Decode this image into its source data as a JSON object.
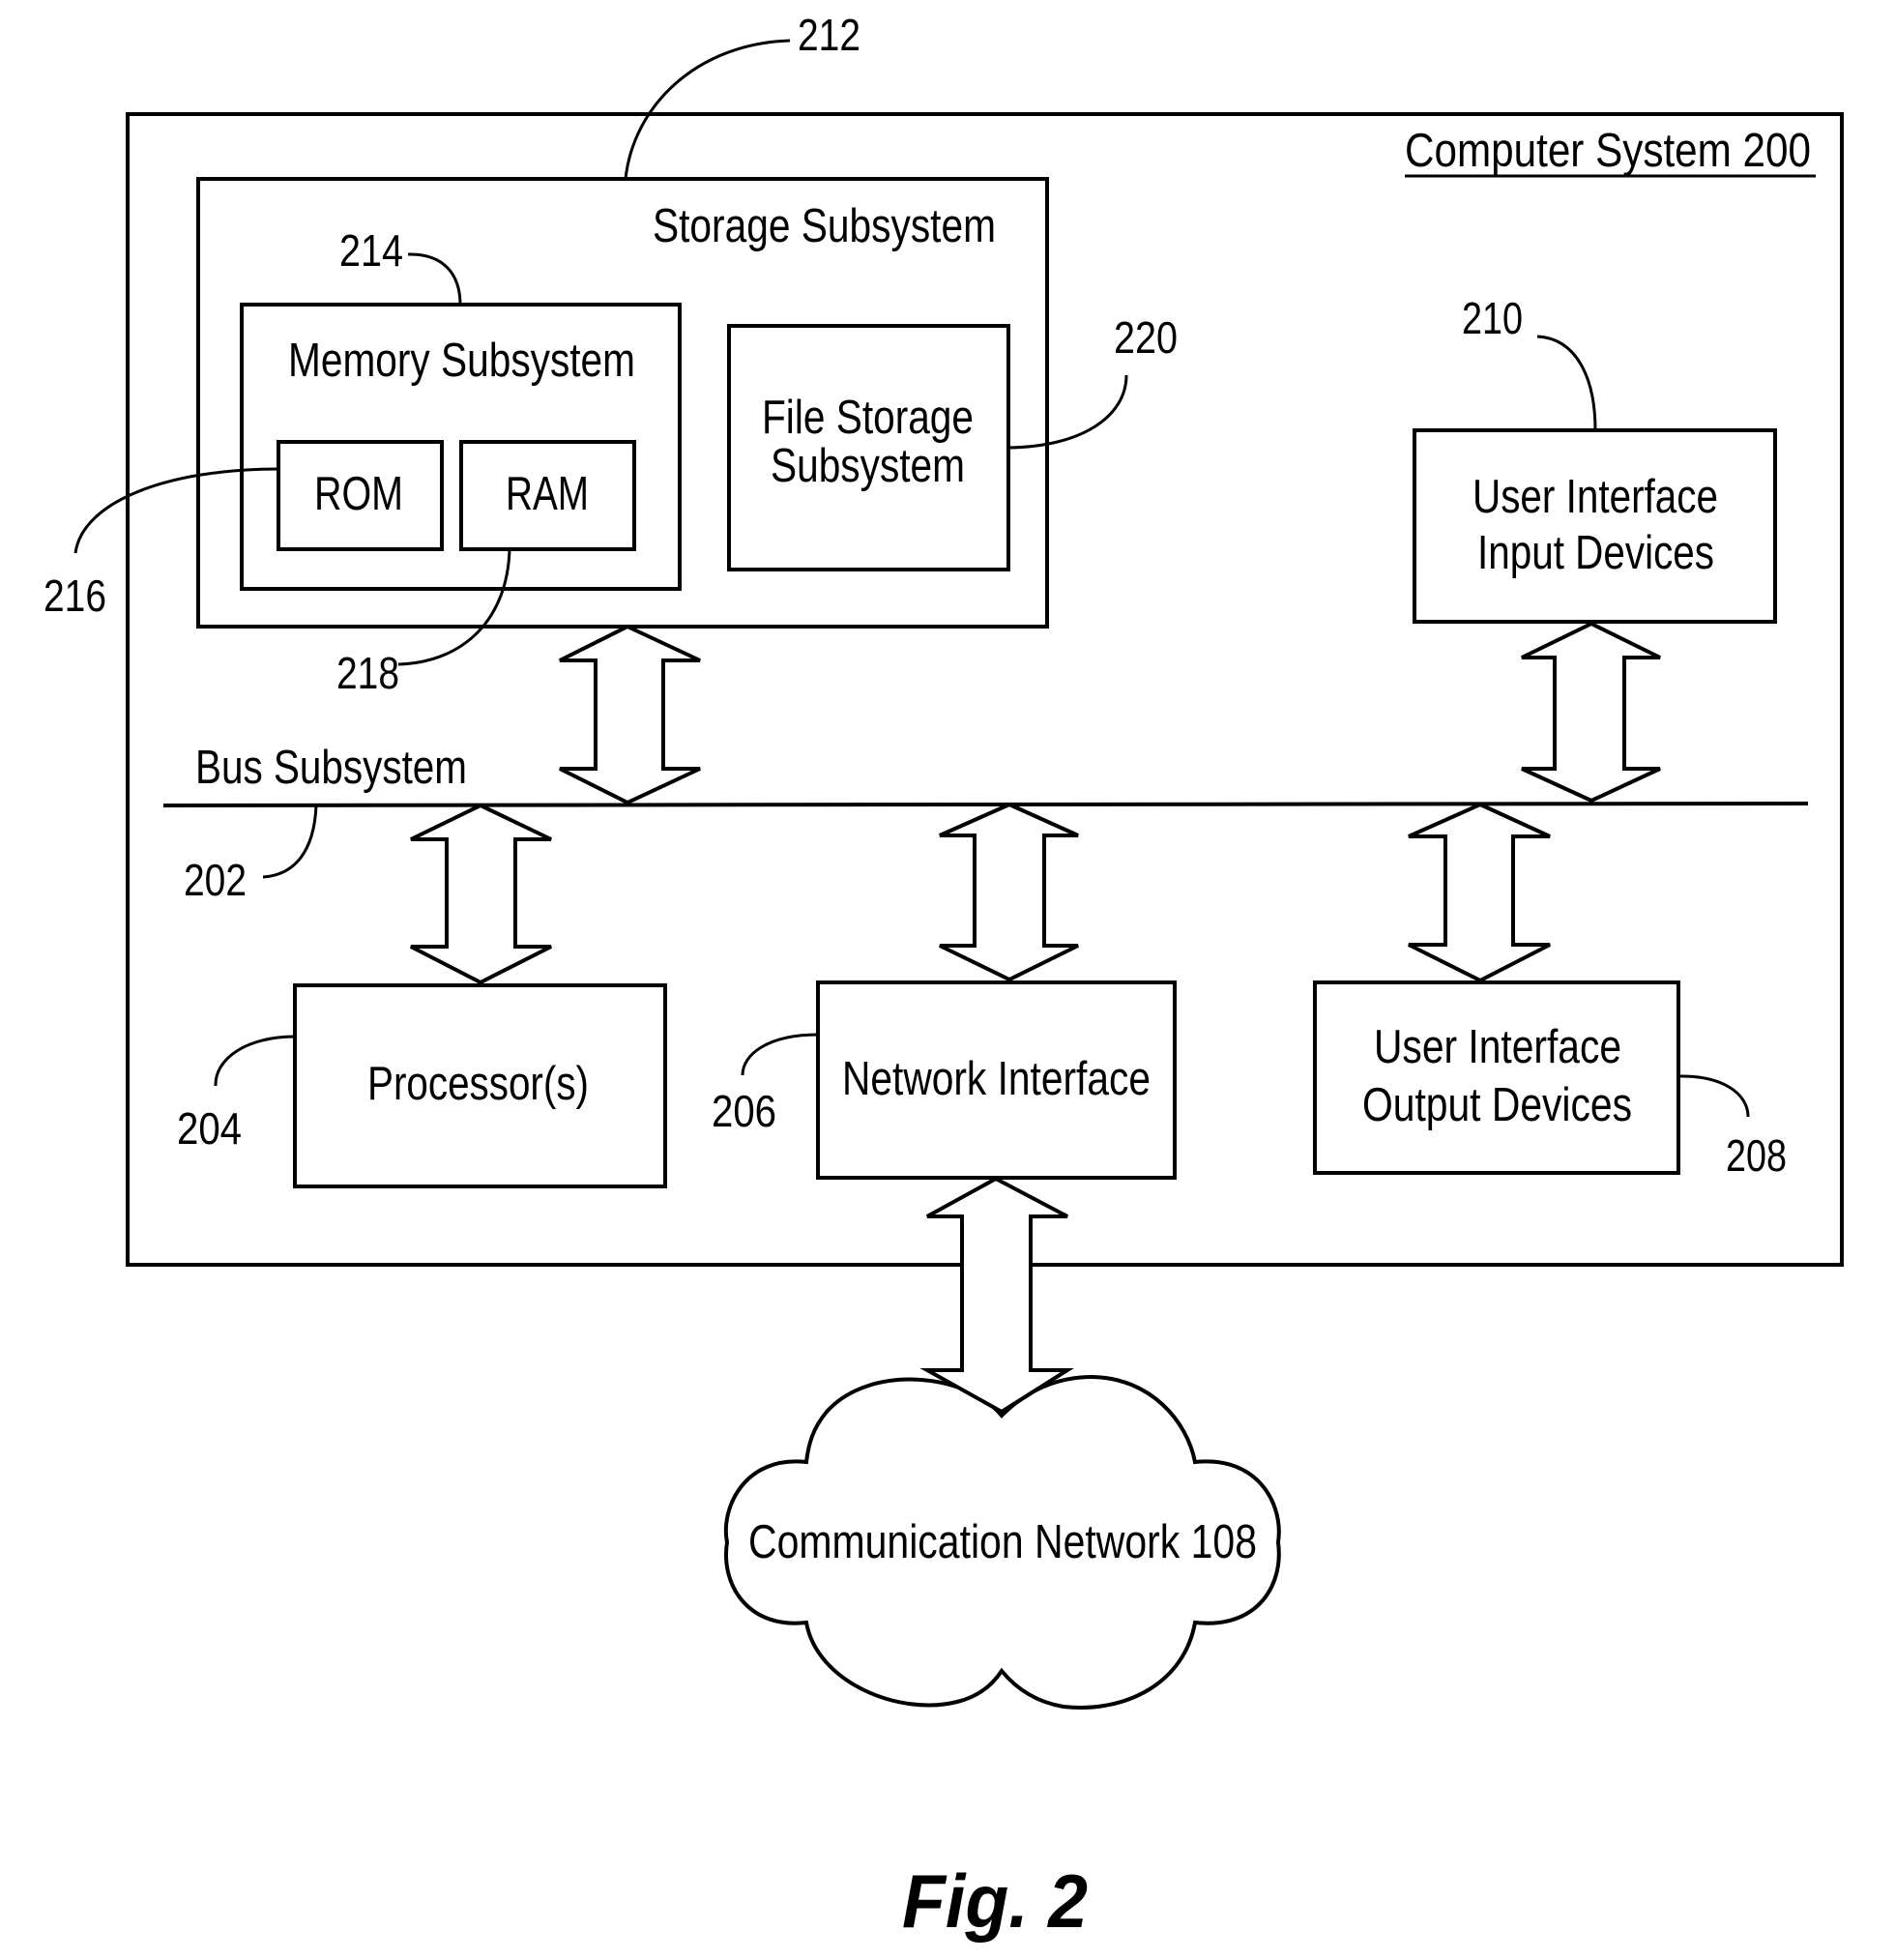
{
  "figure": {
    "caption": "Fig. 2",
    "system_title": "Computer System  200"
  },
  "blocks": {
    "storage": {
      "label": "Storage Subsystem",
      "ref": "212"
    },
    "memory": {
      "label": "Memory Subsystem",
      "ref": "214"
    },
    "rom": {
      "label": "ROM",
      "ref": "216"
    },
    "ram": {
      "label": "RAM",
      "ref": "218"
    },
    "file_storage": {
      "label_lines": [
        "File Storage",
        "Subsystem"
      ],
      "ref": "220"
    },
    "ui_input": {
      "label_lines": [
        "User Interface",
        "Input Devices"
      ],
      "ref": "210"
    },
    "bus": {
      "label": "Bus Subsystem",
      "ref": "202"
    },
    "processor": {
      "label": "Processor(s)",
      "ref": "204"
    },
    "network_interface": {
      "label": "Network Interface",
      "ref": "206"
    },
    "ui_output": {
      "label_lines": [
        "User Interface",
        "Output Devices"
      ],
      "ref": "208"
    },
    "network": {
      "label": "Communication Network 108"
    }
  },
  "connections": [
    {
      "from": "storage",
      "to": "bus",
      "type": "bidirectional"
    },
    {
      "from": "ui_input",
      "to": "bus",
      "type": "bidirectional"
    },
    {
      "from": "bus",
      "to": "processor",
      "type": "bidirectional"
    },
    {
      "from": "bus",
      "to": "network_interface",
      "type": "bidirectional"
    },
    {
      "from": "bus",
      "to": "ui_output",
      "type": "bidirectional"
    },
    {
      "from": "network_interface",
      "to": "network",
      "type": "bidirectional"
    }
  ]
}
